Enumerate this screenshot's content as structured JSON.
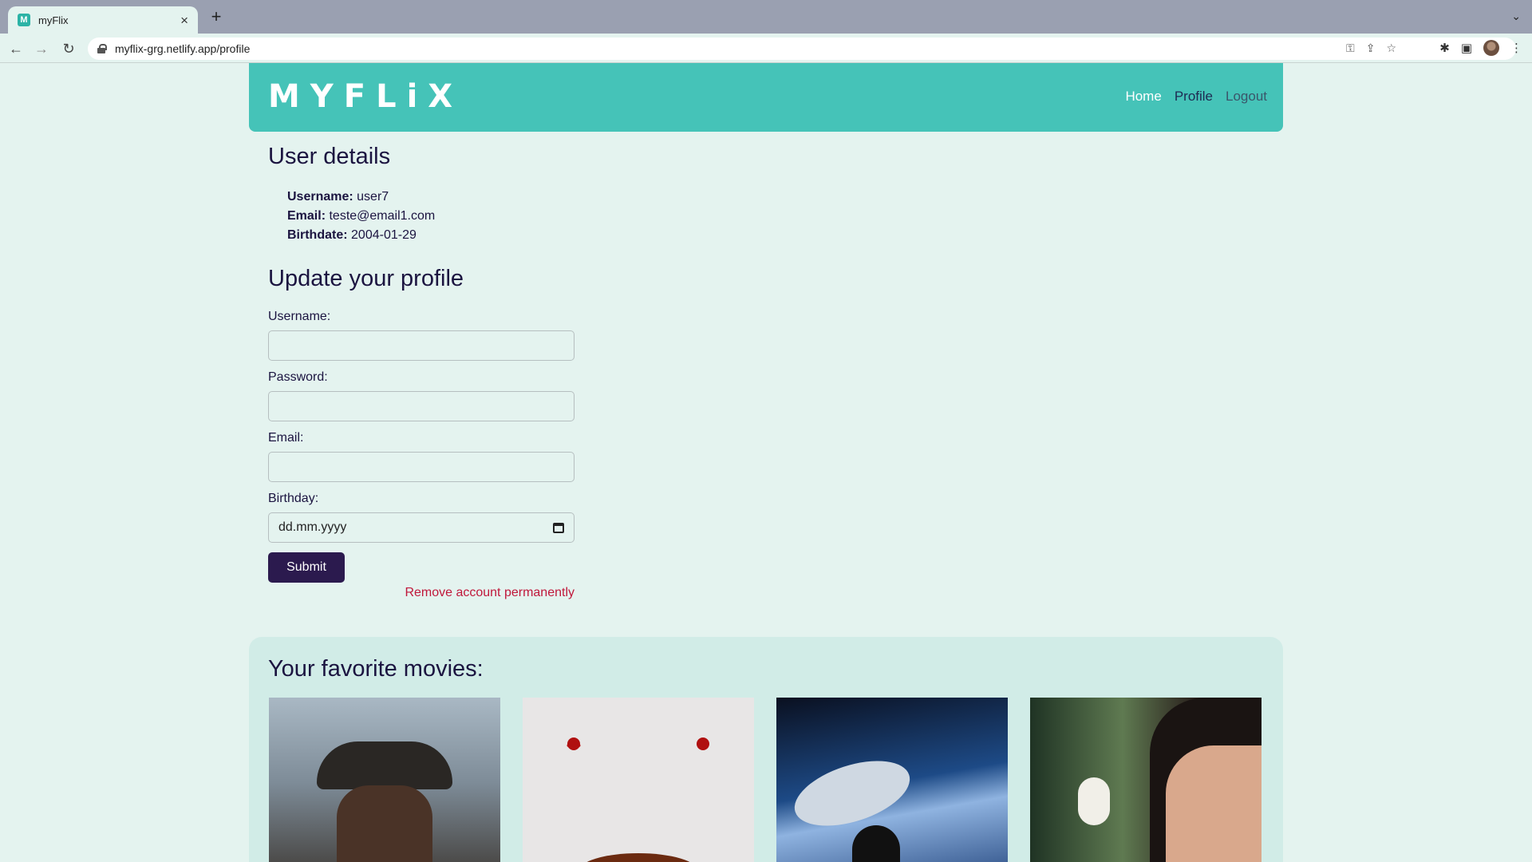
{
  "browser": {
    "tab_title": "myFlix",
    "favicon_letter": "M",
    "url": "myflix-grg.netlify.app/profile"
  },
  "navbar": {
    "logo": "MYFLiX",
    "links": {
      "home": "Home",
      "profile": "Profile",
      "logout": "Logout"
    }
  },
  "user_details": {
    "title": "User details",
    "username_label": "Username:",
    "username": "user7",
    "email_label": "Email:",
    "email": "teste@email1.com",
    "birthdate_label": "Birthdate:",
    "birthdate": "2004-01-29"
  },
  "update_form": {
    "title": "Update your profile",
    "username_label": "Username:",
    "password_label": "Password:",
    "email_label": "Email:",
    "birthday_label": "Birthday:",
    "birthday_placeholder": "dd.mm.yyyy",
    "submit_label": "Submit",
    "remove_label": "Remove account permanently"
  },
  "favorites": {
    "title": "Your favorite movies:"
  },
  "colors": {
    "page_bg": "#e4f3ef",
    "navbar": "#45c3b8",
    "primary_button": "#2b1a4e",
    "danger": "#c0183b"
  }
}
